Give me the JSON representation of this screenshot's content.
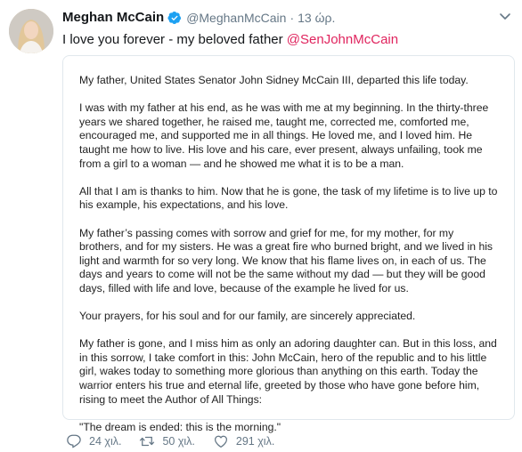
{
  "user": {
    "name": "Meghan McCain",
    "handle": "@MeghanMcCain",
    "separator": "·",
    "time": "13 ώρ."
  },
  "tweet": {
    "text_prefix": "I love you forever - my beloved father ",
    "mention": "@SenJohnMcCain"
  },
  "statement": {
    "paragraphs": [
      "My father, United States Senator John Sidney McCain III, departed this life today.",
      "I was with my father at his end, as he was with me at my beginning. In the thirty-three years we shared together, he raised me, taught me, corrected me, comforted me, encouraged me, and supported me in all things. He loved me, and I loved him. He taught me how to live. His love and his care, ever present, always unfailing, took me from a girl to a woman — and he showed me what it is to be a man.",
      "All that I am is thanks to him. Now that he is gone, the task of my lifetime is to live up to his example, his expectations, and his love.",
      "My father’s passing comes with sorrow and grief for me, for my mother, for my brothers, and for my sisters. He was a great fire who burned bright, and we lived in his light and warmth for so very long. We know that his flame lives on, in each of us. The days and years to come will not be the same without my dad — but they will be good days, filled with life and love, because of the example he lived for us.",
      "Your prayers, for his soul and for our family, are sincerely appreciated.",
      "My father is gone, and I miss him as only an adoring daughter can. But in this loss, and in this sorrow, I take comfort in this: John McCain, hero of the republic and to his little girl, wakes today to something more glorious than anything on this earth. Today the warrior enters his true and eternal life, greeted by those who have gone before him, rising to meet the Author of All Things:",
      "\"The dream is ended: this is the morning.\""
    ]
  },
  "actions": {
    "replies": "24 χιλ.",
    "retweets": "50 χιλ.",
    "likes": "291 χιλ."
  },
  "icons": {
    "verified": "verified-badge-icon",
    "caret": "chevron-down-icon",
    "reply": "reply-icon",
    "retweet": "retweet-icon",
    "like": "heart-icon"
  },
  "colors": {
    "verified": "#1da1f2",
    "mention": "#e0245e",
    "secondary_text": "#657786"
  }
}
